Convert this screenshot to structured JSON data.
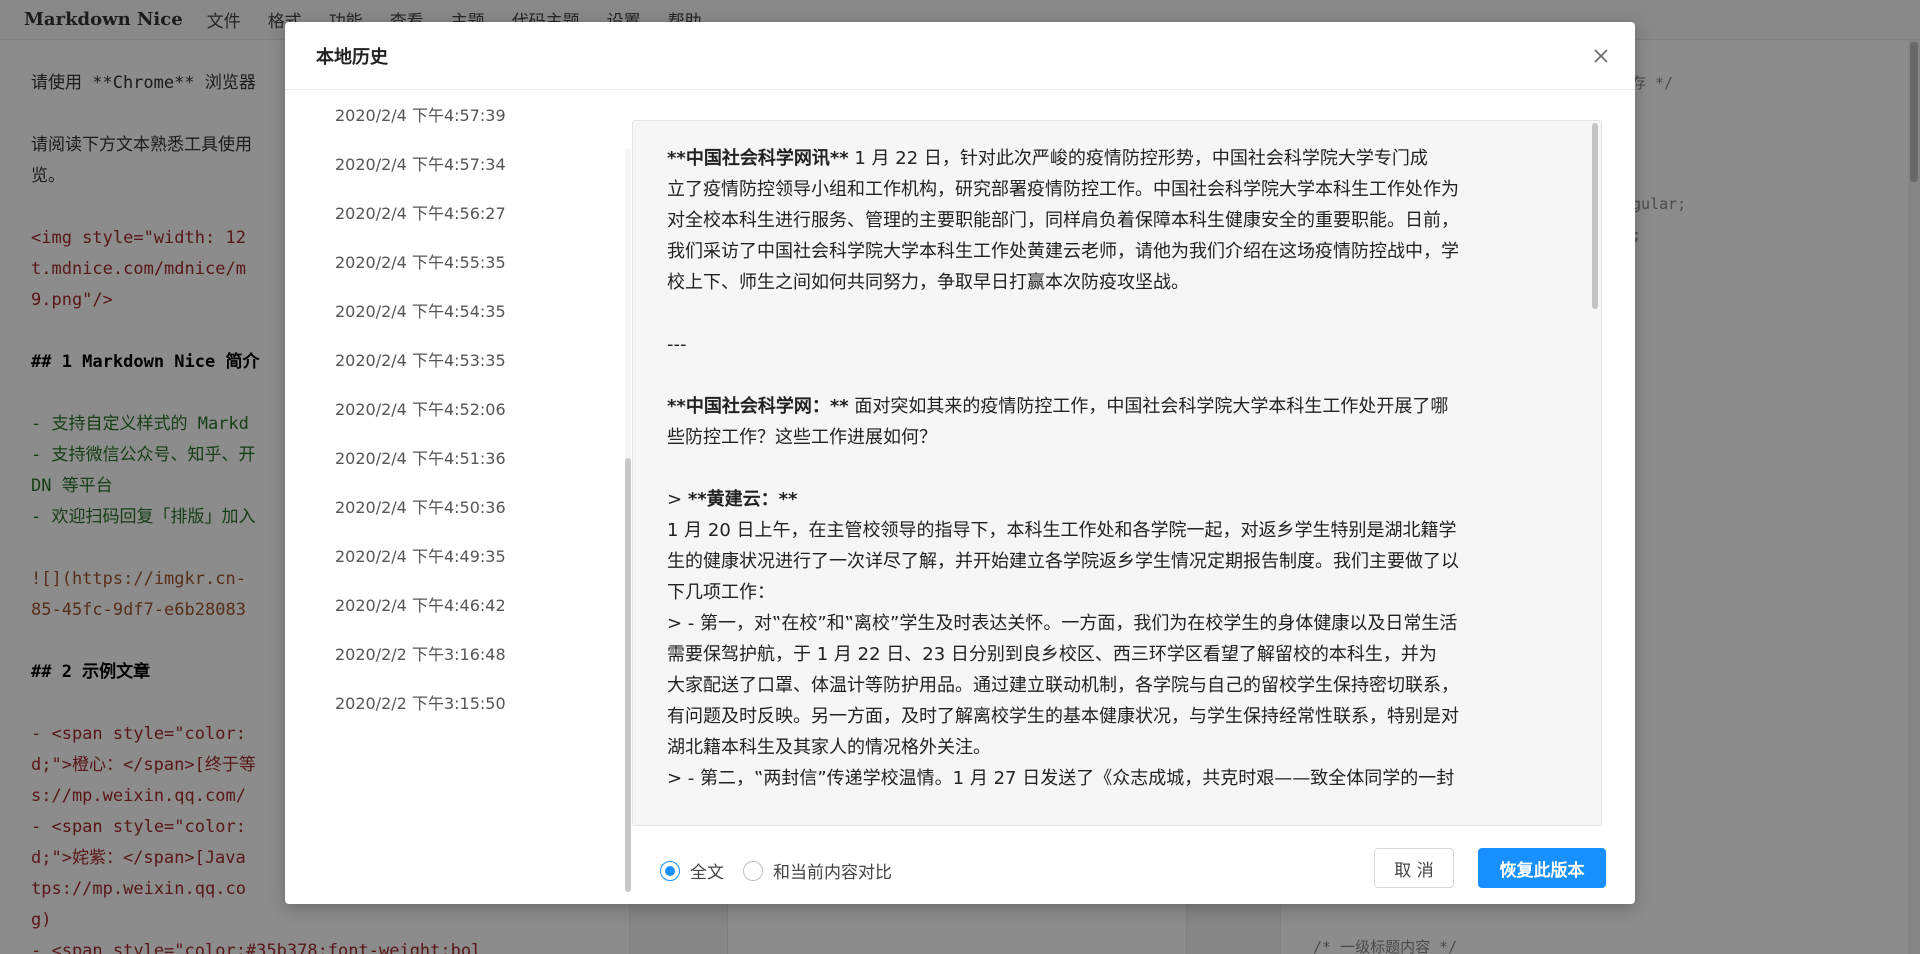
{
  "app": {
    "brand": "Markdown Nice",
    "menu": [
      "文件",
      "格式",
      "功能",
      "查看",
      "主题",
      "代码主题",
      "设置",
      "帮助"
    ]
  },
  "editor": {
    "lines": [
      {
        "text": "请使用 **Chrome** 浏览器",
        "kind": "plain"
      },
      {
        "text": "",
        "kind": "gap"
      },
      {
        "text": "请阅读下方文本熟悉工具使用",
        "kind": "plain"
      },
      {
        "text": "览。",
        "kind": "plain"
      },
      {
        "text": "",
        "kind": "gap"
      },
      {
        "text": "<img style=\"width: 12",
        "kind": "tag"
      },
      {
        "text": "t.mdnice.com/mdnice/m",
        "kind": "tag"
      },
      {
        "text": "9.png\"/>",
        "kind": "tag"
      },
      {
        "text": "",
        "kind": "gap"
      },
      {
        "text": "## 1 Markdown Nice 简介",
        "kind": "head"
      },
      {
        "text": "",
        "kind": "gap"
      },
      {
        "text": "- 支持自定义样式的 Markd",
        "kind": "list"
      },
      {
        "text": "- 支持微信公众号、知乎、开",
        "kind": "list"
      },
      {
        "text": "DN 等平台",
        "kind": "list"
      },
      {
        "text": "- 欢迎扫码回复「排版」加入",
        "kind": "list"
      },
      {
        "text": "",
        "kind": "gap"
      },
      {
        "text": "![](https://imgkr.cn-",
        "kind": "link"
      },
      {
        "text": "85-45fc-9df7-e6b28083",
        "kind": "link"
      },
      {
        "text": "",
        "kind": "gap"
      },
      {
        "text": "## 2 示例文章",
        "kind": "head"
      },
      {
        "text": "",
        "kind": "gap"
      },
      {
        "text": "- <span style=\"color:",
        "kind": "tag"
      },
      {
        "text": "d;\">橙心：</span>[终于等",
        "kind": "tag"
      },
      {
        "text": "s://mp.weixin.qq.com/",
        "kind": "tag"
      },
      {
        "text": "- <span style=\"color:",
        "kind": "tag"
      },
      {
        "text": "d;\">姹紫：</span>[Java",
        "kind": "tag"
      },
      {
        "text": "tps://mp.weixin.qq.co",
        "kind": "tag"
      },
      {
        "text": "g)",
        "kind": "tag"
      },
      {
        "text": "- <span style=\"color:#35b378;font-weight:bol",
        "kind": "tag"
      }
    ]
  },
  "css_editor": {
    "lines": [
      "存 */",
      "egular;",
      "l;",
      "/* 一级标题内容 */"
    ]
  },
  "modal": {
    "title": "本地历史",
    "history": [
      "2020/2/4 下午4:57:39",
      "2020/2/4 下午4:57:34",
      "2020/2/4 下午4:56:27",
      "2020/2/4 下午4:55:35",
      "2020/2/4 下午4:54:35",
      "2020/2/4 下午4:53:35",
      "2020/2/4 下午4:52:06",
      "2020/2/4 下午4:51:36",
      "2020/2/4 下午4:50:36",
      "2020/2/4 下午4:49:35",
      "2020/2/4 下午4:46:42",
      "2020/2/2 下午3:16:48",
      "2020/2/2 下午3:15:50"
    ],
    "content_lines": [
      "**中国社会科学网讯**  1 月 22 日，针对此次严峻的疫情防控形势，中国社会科学院大学专门成",
      "立了疫情防控领导小组和工作机构，研究部署疫情防控工作。中国社会科学院大学本科生工作处作为",
      "对全校本科生进行服务、管理的主要职能部门，同样肩负着保障本科生健康安全的重要职能。日前，",
      "我们采访了中国社会科学院大学本科生工作处黄建云老师，请他为我们介绍在这场疫情防控战中，学",
      "校上下、师生之间如何共同努力，争取早日打赢本次防疫攻坚战。",
      "",
      "---",
      "",
      "**中国社会科学网：** 面对突如其来的疫情防控工作，中国社会科学院大学本科生工作处开展了哪",
      "些防控工作？这些工作进展如何？",
      "",
      "> **黄建云：**",
      "1 月 20 日上午，在主管校领导的指导下，本科生工作处和各学院一起，对返乡学生特别是湖北籍学",
      "生的健康状况进行了一次详尽了解，并开始建立各学院返乡学生情况定期报告制度。我们主要做了以",
      "下几项工作：",
      "> - 第一，对‟在校”和‟离校”学生及时表达关怀。一方面，我们为在校学生的身体健康以及日常生活",
      "需要保驾护航，于 1 月 22 日、23 日分别到良乡校区、西三环学区看望了解留校的本科生，并为",
      "大家配送了口罩、体温计等防护用品。通过建立联动机制，各学院与自己的留校学生保持密切联系，",
      "有问题及时反映。另一方面，及时了解离校学生的基本健康状况，与学生保持经常性联系，特别是对",
      "湖北籍本科生及其家人的情况格外关注。",
      "> - 第二，‟两封信”传递学校温情。1 月 27 日发送了《众志成城，共克时艰——致全体同学的一封"
    ],
    "radio_full": "全文",
    "radio_compare": "和当前内容对比",
    "selected_mode": "全文",
    "cancel_label": "取 消",
    "restore_label": "恢复此版本"
  },
  "colors": {
    "primary": "#1890ff",
    "mask": "rgba(0,0,0,0.45)"
  }
}
